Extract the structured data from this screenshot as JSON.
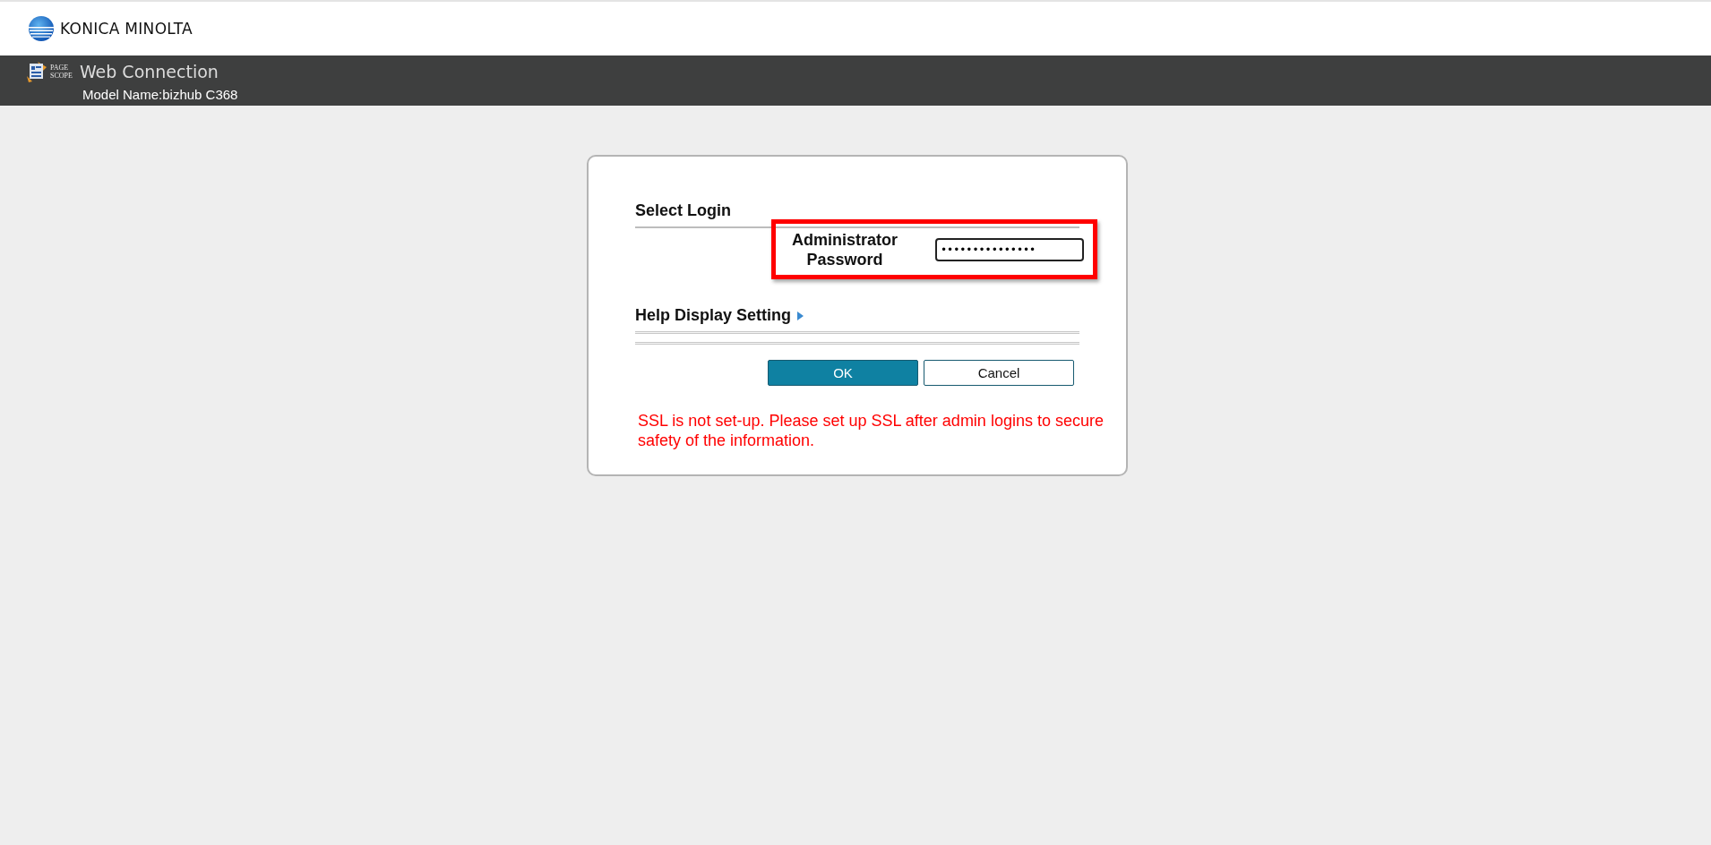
{
  "brand": {
    "name": "KONICA MINOLTA"
  },
  "header": {
    "product_mark": [
      "PAGE",
      "SCOPE"
    ],
    "title": "Web Connection",
    "model": "Model Name:bizhub C368"
  },
  "login": {
    "heading": "Select Login",
    "field": {
      "label": [
        "Administrator",
        "Password"
      ],
      "value": "•••••••••••••••",
      "highlighted": true
    },
    "help": {
      "label": "Help Display Setting",
      "expanded": false
    },
    "buttons": [
      {
        "label": "OK",
        "primary": true
      },
      {
        "label": "Cancel",
        "primary": false
      }
    ],
    "warning": "SSL is not set-up. Please set up SSL after admin logins to secure safety of the information."
  }
}
